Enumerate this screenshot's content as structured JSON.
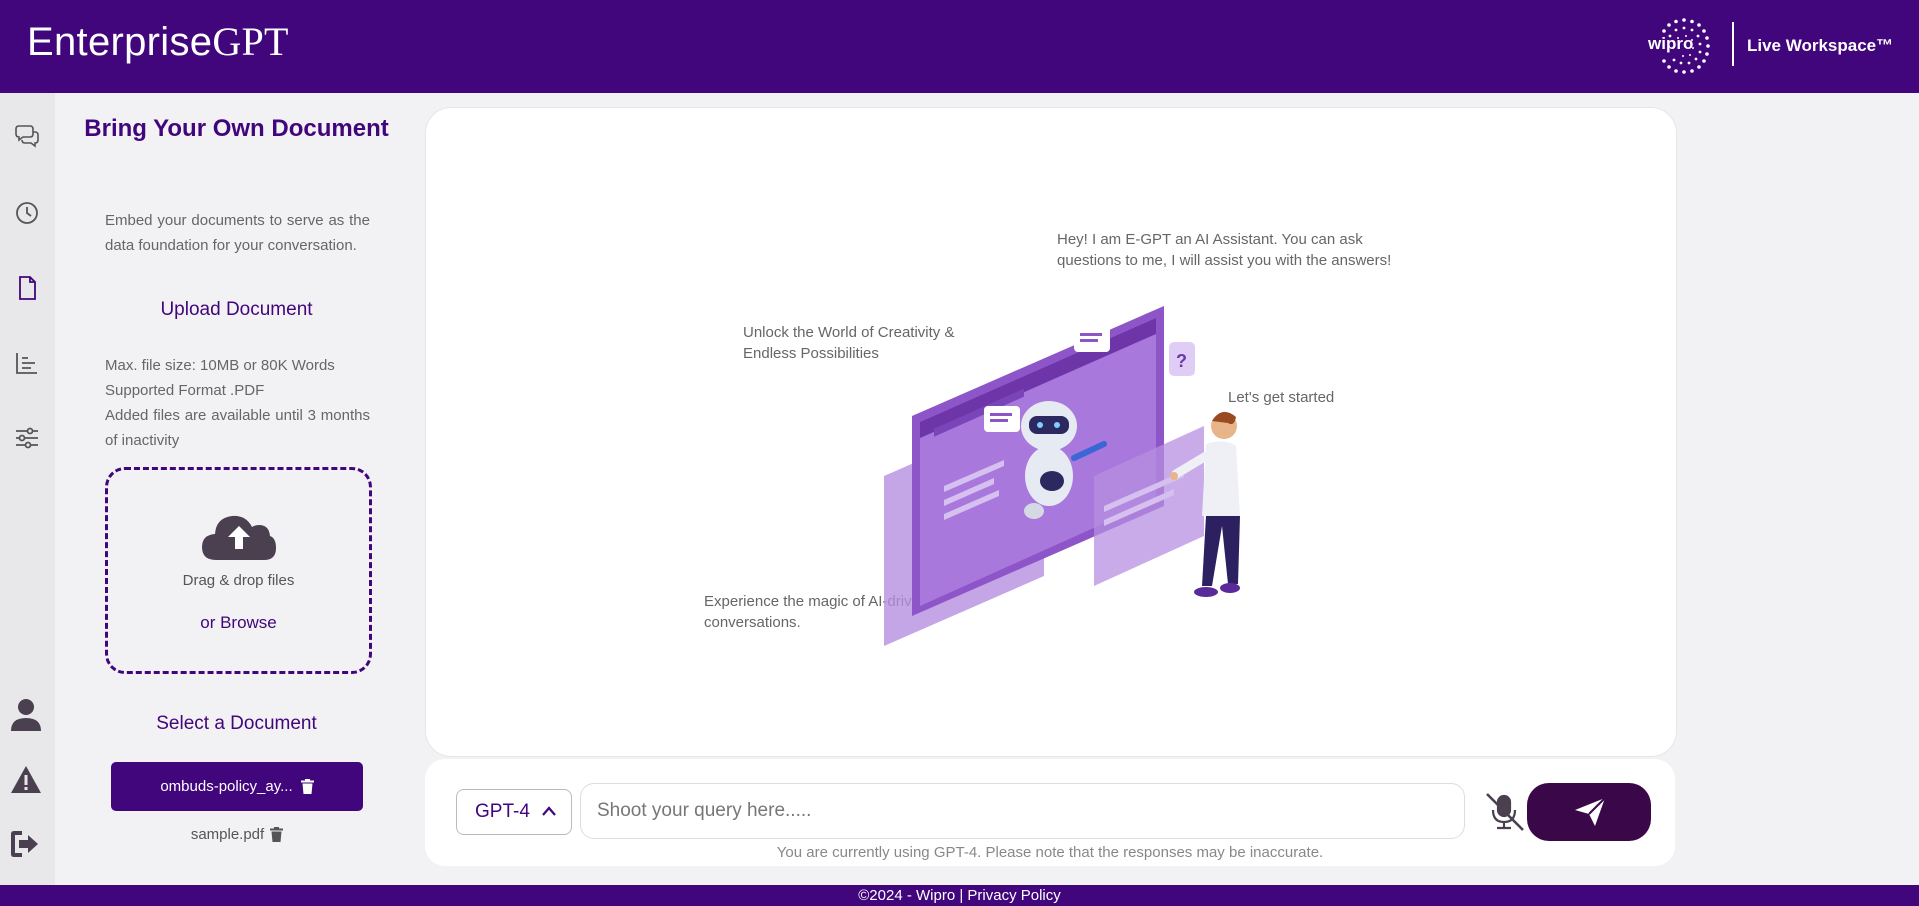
{
  "header": {
    "brand_part1": "Enterprise",
    "brand_part2": "GPT",
    "logo_text": "wipro",
    "workspace": "Live Workspace™"
  },
  "rail": {
    "icons": [
      "chat-icon",
      "history-icon",
      "document-icon",
      "analytics-icon",
      "settings-sliders-icon",
      "user-icon",
      "warning-icon",
      "logout-icon"
    ]
  },
  "panel": {
    "title": "Bring Your Own Document",
    "description": "Embed your documents to serve as the data foundation for your conversation.",
    "upload_title": "Upload Document",
    "upload_info": [
      "Max. file size: 10MB or 80K Words",
      "Supported Format .PDF",
      "Added files are available until 3 months of inactivity"
    ],
    "drag_text": "Drag & drop files",
    "browse_text": "or Browse",
    "select_title": "Select a Document",
    "documents": [
      {
        "name": "ombuds-policy_ay...",
        "selected": true
      },
      {
        "name": "sample.pdf",
        "selected": false
      }
    ]
  },
  "hero": {
    "greeting": "Hey! I am E-GPT an AI Assistant. You can ask questions to me, I will assist you with the answers!",
    "creativity": "Unlock the World of Creativity & Endless Possibilities",
    "started": "Let's get started",
    "magic": "Experience the magic of AI-driven conversations."
  },
  "composer": {
    "model": "GPT-4",
    "placeholder": "Shoot your query here.....",
    "disclaimer": "You are currently using GPT-4. Please note that the responses may be inaccurate."
  },
  "footer": {
    "copyright": "©2024 - Wipro",
    "separator": " | ",
    "privacy": "Privacy Policy"
  },
  "colors": {
    "brand": "#41057c",
    "send_button": "#3a0848",
    "illustration": "#a070d0"
  }
}
